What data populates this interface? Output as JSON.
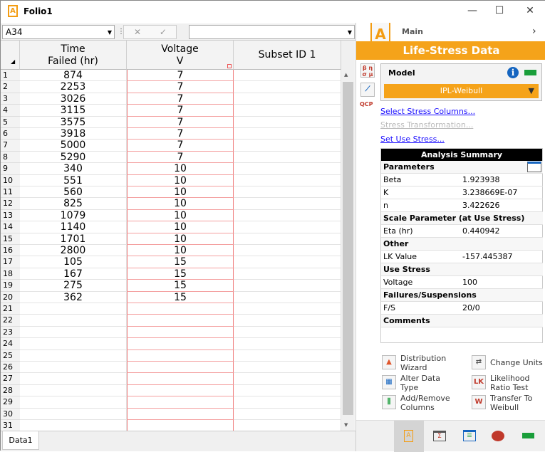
{
  "window": {
    "title": "Folio1",
    "minimize": "—",
    "maximize": "☐",
    "close": "✕"
  },
  "formula_bar": {
    "cell_ref": "A34",
    "cancel": "✕",
    "confirm": "✓",
    "value": ""
  },
  "columns": [
    {
      "line1": "Time",
      "line2": "Failed (hr)"
    },
    {
      "line1": "Voltage",
      "line2": "V"
    },
    {
      "line1": "Subset ID 1",
      "line2": ""
    }
  ],
  "rows": [
    [
      "874",
      "7"
    ],
    [
      "2253",
      "7"
    ],
    [
      "3026",
      "7"
    ],
    [
      "3115",
      "7"
    ],
    [
      "3575",
      "7"
    ],
    [
      "3918",
      "7"
    ],
    [
      "5000",
      "7"
    ],
    [
      "5290",
      "7"
    ],
    [
      "340",
      "10"
    ],
    [
      "551",
      "10"
    ],
    [
      "560",
      "10"
    ],
    [
      "825",
      "10"
    ],
    [
      "1079",
      "10"
    ],
    [
      "1140",
      "10"
    ],
    [
      "1701",
      "10"
    ],
    [
      "2800",
      "10"
    ],
    [
      "105",
      "15"
    ],
    [
      "167",
      "15"
    ],
    [
      "275",
      "15"
    ],
    [
      "362",
      "15"
    ]
  ],
  "row_count": 31,
  "sheet_tab": "Data1",
  "panel": {
    "nav_label": "Main",
    "nav_arrow": "›",
    "header": "Life-Stress Data",
    "model_label": "Model",
    "model_value": "IPL-Weibull",
    "links": [
      "Select Stress Columns...",
      "Stress Transformation...",
      "Set Use Stress..."
    ],
    "summary_title": "Analysis Summary",
    "summary": [
      {
        "section": "Parameters"
      },
      {
        "label": "Beta",
        "value": "1.923938"
      },
      {
        "label": "K",
        "value": "3.238669E-07"
      },
      {
        "label": "n",
        "value": "3.422626"
      },
      {
        "section": "Scale Parameter (at Use Stress)"
      },
      {
        "label": "Eta (hr)",
        "value": "0.440942"
      },
      {
        "section": "Other"
      },
      {
        "label": "LK Value",
        "value": "-157.445387"
      },
      {
        "section": "Use Stress"
      },
      {
        "label": "Voltage",
        "value": "100"
      },
      {
        "section": "Failures/Suspensions"
      },
      {
        "label": "F/S",
        "value": "20/0"
      },
      {
        "section": "Comments"
      }
    ],
    "actions": [
      {
        "l1": "Distribution",
        "l2": "Wizard"
      },
      {
        "l1": "Change Units",
        "l2": ""
      },
      {
        "l1": "Alter Data",
        "l2": "Type"
      },
      {
        "l1": "Likelihood",
        "l2": "Ratio Test"
      },
      {
        "l1": "Add/Remove",
        "l2": "Columns"
      },
      {
        "l1": "Transfer To",
        "l2": "Weibull"
      }
    ],
    "params_icon_text": "β η σ μ",
    "qcp_text": "QCP",
    "lk_text": "LK",
    "w_text": "W",
    "colors": {
      "accent": "#f5a31a",
      "green": "#1a9e3a",
      "info": "#1565c0"
    }
  }
}
